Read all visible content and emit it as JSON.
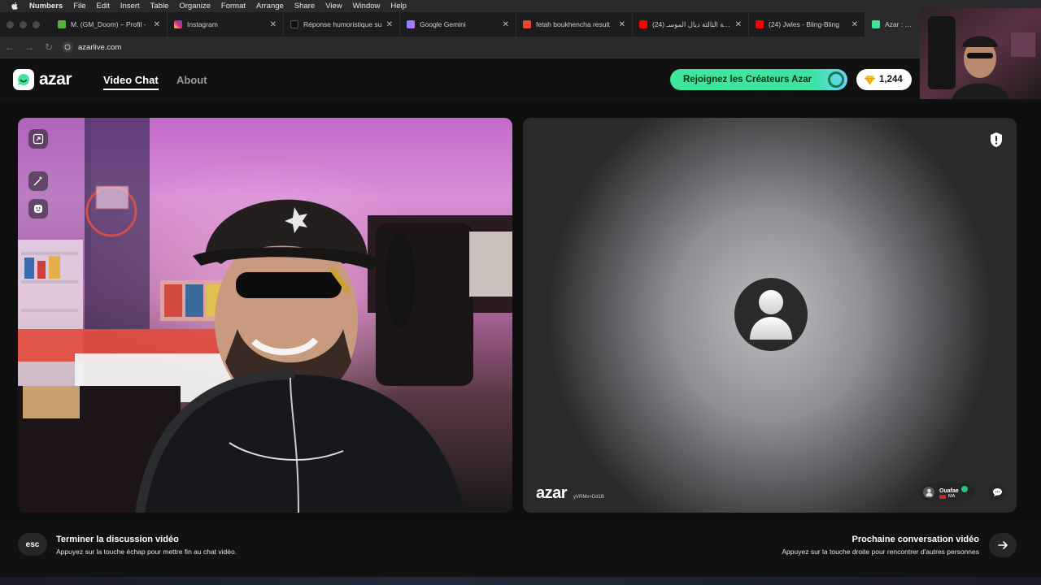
{
  "menubar": {
    "app": "Numbers",
    "items": [
      "File",
      "Edit",
      "Insert",
      "Table",
      "Organize",
      "Format",
      "Arrange",
      "Share",
      "View",
      "Window",
      "Help"
    ]
  },
  "tabs": [
    {
      "label": "M. (GM_Doom) – Profil -",
      "icon_color": "#5ab03a"
    },
    {
      "label": "Instagram",
      "icon_color": "#e1306c"
    },
    {
      "label": "Réponse humoristique su",
      "icon_color": "#ffffff"
    },
    {
      "label": "Google Gemini",
      "icon_color": "#6a8cff"
    },
    {
      "label": "fetah boukhencha result",
      "icon_color": "#e84a2b"
    },
    {
      "label": "(24) الحلقة الثالثة ديال الموسـ",
      "icon_color": "#ff0000"
    },
    {
      "label": "(24) Jwles - Bling-Bling",
      "icon_color": "#ff0000"
    },
    {
      "label": "Azar : Chat V",
      "icon_color": "#3ee69c"
    }
  ],
  "address": {
    "url": "azarlive.com"
  },
  "header": {
    "logo": "azar",
    "nav_video": "Video Chat",
    "nav_about": "About",
    "creators_label": "Rejoignez les Créateurs Azar",
    "gems_count": "1,244"
  },
  "remote": {
    "watermark": "azar",
    "watermark_id": "yVRMv+Dd1B",
    "partner_name": "Ouafae",
    "partner_country": "MA"
  },
  "bottom": {
    "esc_label": "esc",
    "end_title": "Terminer la discussion vidéo",
    "end_hint": "Appuyez sur la touche échap pour mettre fin au chat vidéo.",
    "next_title": "Prochaine conversation vidéo",
    "next_hint": "Appuyez sur la touche droite pour rencontrer d'autres personnes"
  },
  "colors": {
    "accent_green": "#3ee69c",
    "background": "#111111"
  }
}
